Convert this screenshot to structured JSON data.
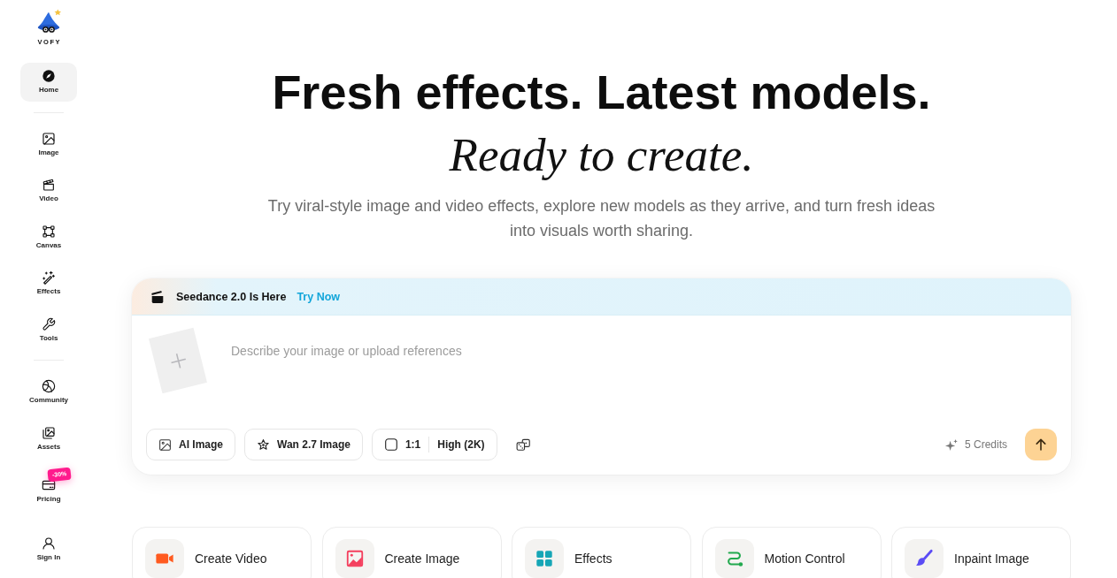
{
  "sidebar": {
    "logo": {
      "text": "VOFY"
    },
    "sections": [
      {
        "items": [
          {
            "label": "Home",
            "selected": true
          }
        ]
      },
      {
        "items": [
          {
            "label": "Image",
            "selected": false
          },
          {
            "label": "Video",
            "selected": false
          },
          {
            "label": "Canvas",
            "selected": false
          },
          {
            "label": "Effects",
            "selected": false
          },
          {
            "label": "Tools",
            "selected": false
          }
        ]
      },
      {
        "items": [
          {
            "label": "Community",
            "selected": false
          },
          {
            "label": "Assets",
            "selected": false
          },
          {
            "label": "Pricing",
            "selected": false,
            "badge": "-30%"
          }
        ]
      }
    ],
    "account": {
      "label": "Sign In"
    }
  },
  "hero": {
    "title": "Fresh effects. Latest models.",
    "subtitle": "Ready to create.",
    "description": "Try viral-style image and video effects, explore new models as they arrive, and turn fresh ideas into visuals worth sharing."
  },
  "composer": {
    "banner": {
      "text": "Seedance 2.0 Is Here",
      "link": "Try Now"
    },
    "prompt": {
      "placeholder": "Describe your image or upload references"
    },
    "options": [
      {
        "label": "AI Image"
      },
      {
        "label": "Wan 2.7 Image"
      }
    ],
    "settings": {
      "aspect_ratio": "1:1",
      "quality": "High (2K)"
    },
    "credits": "5 Credits"
  },
  "features": [
    {
      "label": "Create Video"
    },
    {
      "label": "Create Image"
    },
    {
      "label": "Effects"
    },
    {
      "label": "Motion Control"
    },
    {
      "label": "Inpaint Image"
    }
  ]
}
